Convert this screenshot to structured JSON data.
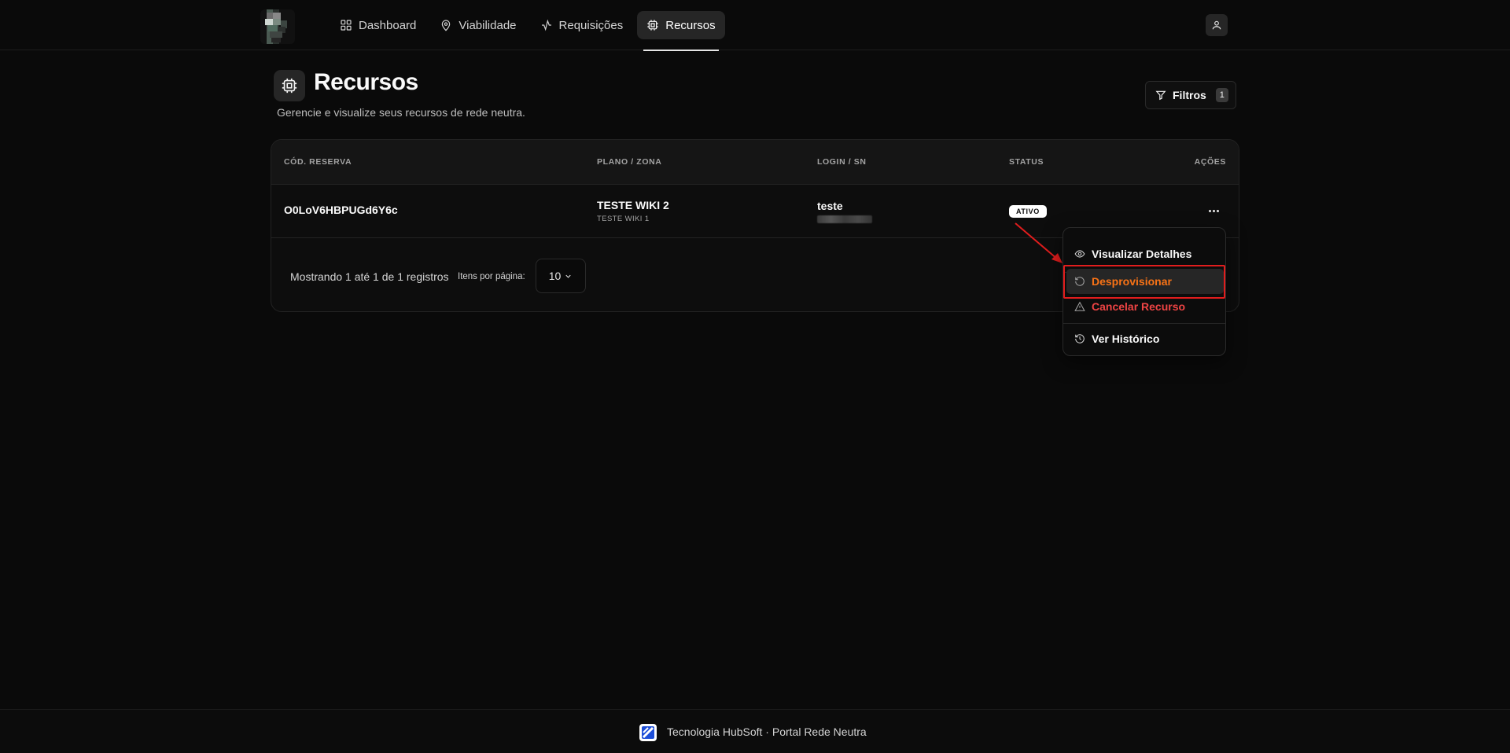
{
  "nav": {
    "items": [
      {
        "label": "Dashboard",
        "icon": "grid-icon"
      },
      {
        "label": "Viabilidade",
        "icon": "map-pin-icon"
      },
      {
        "label": "Requisições",
        "icon": "activity-icon"
      },
      {
        "label": "Recursos",
        "icon": "cpu-icon",
        "active": true
      }
    ]
  },
  "header": {
    "title": "Recursos",
    "subtitle": "Gerencie e visualize seus recursos de rede neutra.",
    "filter_label": "Filtros",
    "filter_count": "1"
  },
  "table": {
    "columns": [
      "CÓD. RESERVA",
      "PLANO / ZONA",
      "LOGIN / SN",
      "STATUS",
      "AÇÕES"
    ],
    "rows": [
      {
        "code": "O0LoV6HBPUGd6Y6c",
        "plan": "TESTE WIKI 2",
        "zone": "TESTE WIKI 1",
        "login": "teste",
        "status": "ATIVO"
      }
    ],
    "showing": "Mostrando 1 até 1 de 1 registros",
    "per_page_label": "Itens por página:",
    "per_page_value": "10"
  },
  "menu": {
    "items": [
      {
        "label": "Visualizar Detalhes",
        "icon": "eye-icon"
      },
      {
        "label": "Desprovisionar",
        "icon": "rotate-ccw-icon",
        "color": "#f97316"
      },
      {
        "label": "Cancelar Recurso",
        "icon": "alert-triangle-icon",
        "color": "#ef4444"
      },
      {
        "label": "Ver Histórico",
        "icon": "history-icon"
      }
    ]
  },
  "footer": {
    "text": "Tecnologia HubSoft · Portal Rede Neutra"
  },
  "colors": {
    "background": "#0a0a0a",
    "accent_orange": "#f97316",
    "danger_red": "#ef4444",
    "annotation_red": "#e11d1d"
  }
}
